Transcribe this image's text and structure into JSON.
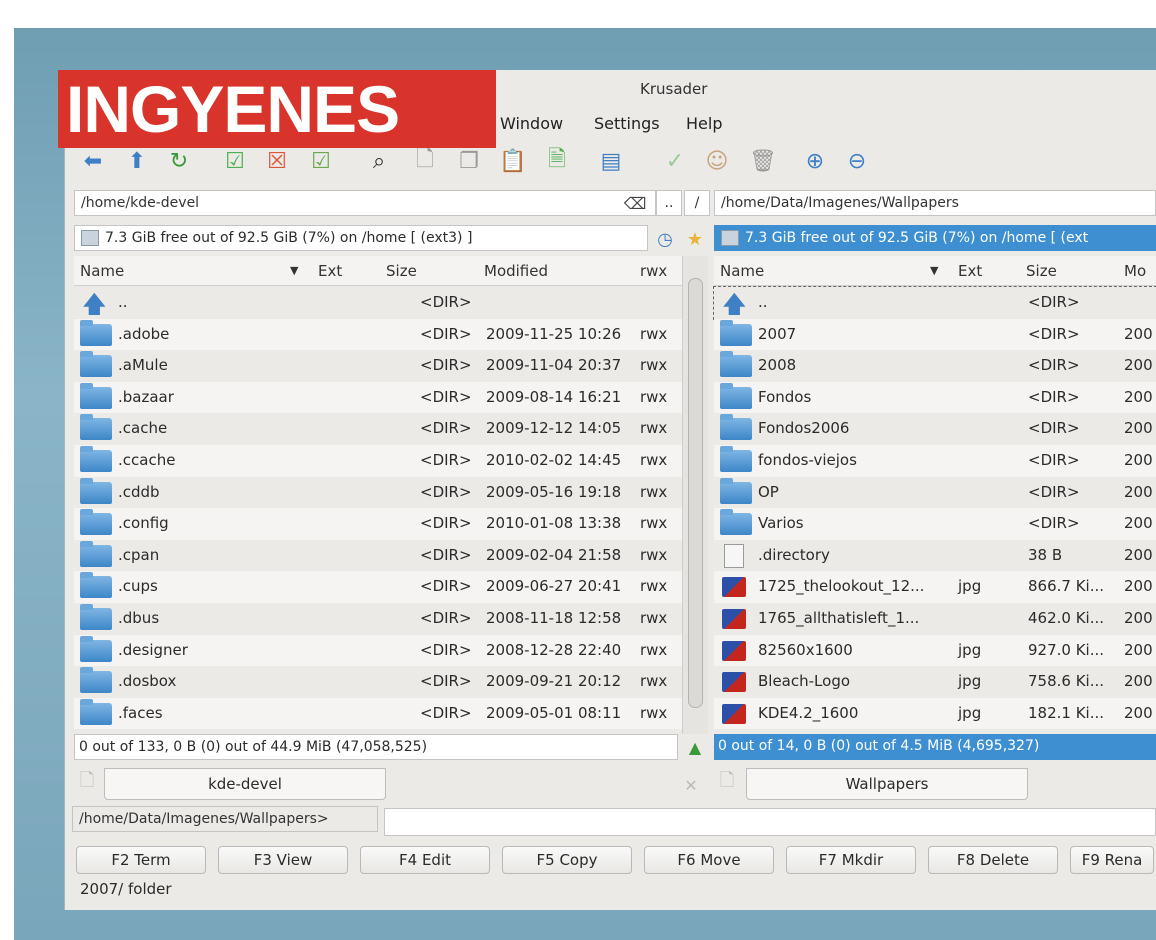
{
  "banner": "INGYENES",
  "title": "Krusader",
  "menu": [
    "Window",
    "Settings",
    "Help"
  ],
  "left": {
    "path": "/home/kde-devel",
    "free": "7.3 GiB free out of 92.5 GiB (7%) on /home [ (ext3) ]",
    "cols": [
      "Name",
      "Ext",
      "Size",
      "Modified",
      "rwx"
    ],
    "rows": [
      [
        "..",
        "",
        "<DIR>",
        "",
        ""
      ],
      [
        ".adobe",
        "",
        "<DIR>",
        "2009-11-25 10:26",
        "rwx"
      ],
      [
        ".aMule",
        "",
        "<DIR>",
        "2009-11-04 20:37",
        "rwx"
      ],
      [
        ".bazaar",
        "",
        "<DIR>",
        "2009-08-14 16:21",
        "rwx"
      ],
      [
        ".cache",
        "",
        "<DIR>",
        "2009-12-12 14:05",
        "rwx"
      ],
      [
        ".ccache",
        "",
        "<DIR>",
        "2010-02-02 14:45",
        "rwx"
      ],
      [
        ".cddb",
        "",
        "<DIR>",
        "2009-05-16 19:18",
        "rwx"
      ],
      [
        ".config",
        "",
        "<DIR>",
        "2010-01-08 13:38",
        "rwx"
      ],
      [
        ".cpan",
        "",
        "<DIR>",
        "2009-02-04 21:58",
        "rwx"
      ],
      [
        ".cups",
        "",
        "<DIR>",
        "2009-06-27 20:41",
        "rwx"
      ],
      [
        ".dbus",
        "",
        "<DIR>",
        "2008-11-18 12:58",
        "rwx"
      ],
      [
        ".designer",
        "",
        "<DIR>",
        "2008-12-28 22:40",
        "rwx"
      ],
      [
        ".dosbox",
        "",
        "<DIR>",
        "2009-09-21 20:12",
        "rwx"
      ],
      [
        ".faces",
        "",
        "<DIR>",
        "2009-05-01 08:11",
        "rwx"
      ]
    ],
    "status": "0 out of 133, 0 B (0) out of 44.9 MiB (47,058,525)",
    "tab": "kde-devel"
  },
  "right": {
    "path": "/home/Data/Imagenes/Wallpapers",
    "free": "7.3 GiB free out of 92.5 GiB (7%) on /home [ (ext",
    "cols": [
      "Name",
      "Ext",
      "Size",
      "Mo"
    ],
    "rows": [
      [
        "..",
        "",
        "<DIR>",
        "",
        "up"
      ],
      [
        "2007",
        "",
        "<DIR>",
        "200",
        "folder"
      ],
      [
        "2008",
        "",
        "<DIR>",
        "200",
        "folder"
      ],
      [
        "Fondos",
        "",
        "<DIR>",
        "200",
        "folder"
      ],
      [
        "Fondos2006",
        "",
        "<DIR>",
        "200",
        "folder"
      ],
      [
        "fondos-viejos",
        "",
        "<DIR>",
        "200",
        "folder"
      ],
      [
        "OP",
        "",
        "<DIR>",
        "200",
        "folder"
      ],
      [
        "Varios",
        "",
        "<DIR>",
        "200",
        "folder"
      ],
      [
        ".directory",
        "",
        "38 B",
        "200",
        "doc"
      ],
      [
        "1725_thelookout_12...",
        "jpg",
        "866.7 Ki...",
        "200",
        "img"
      ],
      [
        "1765_allthatisleft_1...",
        "",
        "462.0 Ki...",
        "200",
        "img"
      ],
      [
        "82560x1600",
        "jpg",
        "927.0 Ki...",
        "200",
        "img"
      ],
      [
        "Bleach-Logo",
        "jpg",
        "758.6 Ki...",
        "200",
        "img"
      ],
      [
        "KDE4.2_1600",
        "jpg",
        "182.1 Ki...",
        "200",
        "img"
      ]
    ],
    "status": "0 out of 14, 0 B (0) out of 4.5 MiB (4,695,327)",
    "tab": "Wallpapers"
  },
  "cmdline": {
    "prompt": "/home/Data/Imagenes/Wallpapers>"
  },
  "fkeys": [
    "F2 Term",
    "F3 View",
    "F4 Edit",
    "F5 Copy",
    "F6 Move",
    "F7 Mkdir",
    "F8 Delete",
    "F9 Rena"
  ],
  "statusbar": "2007/  folder",
  "colors": {
    "accent": "#3d8fd1",
    "banner": "#d9342b"
  }
}
